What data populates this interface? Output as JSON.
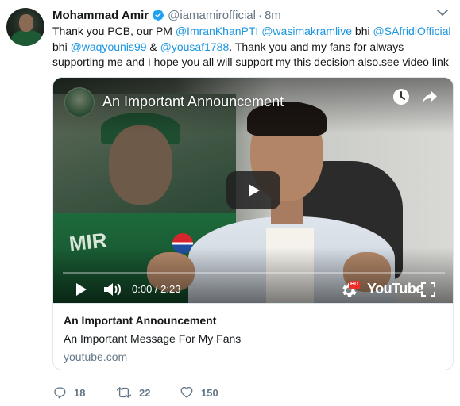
{
  "author": {
    "name": "Mohammad Amir",
    "handle": "@iamamirofficial",
    "separator": "·",
    "time": "8m",
    "verified_icon": "verified-badge-icon"
  },
  "tweet": {
    "lines": [
      [
        {
          "text": "Thank you PCB, our PM ",
          "mention": false
        },
        {
          "text": "@ImranKhanPTI",
          "mention": true
        },
        {
          "text": " ",
          "mention": false
        },
        {
          "text": "@wasimakramlive",
          "mention": true
        },
        {
          "text": " bhi ",
          "mention": false
        },
        {
          "text": "@SAfridiOfficial",
          "mention": true
        }
      ],
      [
        {
          "text": "bhi ",
          "mention": false
        },
        {
          "text": "@waqyounis99",
          "mention": true
        },
        {
          "text": " & ",
          "mention": false
        },
        {
          "text": "@yousaf1788",
          "mention": true
        },
        {
          "text": ". Thank you and my fans for always",
          "mention": false
        }
      ],
      [
        {
          "text": "supporting me and I hope you all will support my this decision also.see video link",
          "mention": false
        }
      ]
    ]
  },
  "video": {
    "title": "An Important Announcement",
    "time": "0:00 / 2:23",
    "platform": "YouTube",
    "hd_label": "HD",
    "progress_fraction": 0.0,
    "poster_text": "MIR"
  },
  "card": {
    "title": "An Important Announcement",
    "description": "An Important Message For My Fans",
    "domain": "youtube.com"
  },
  "actions": {
    "replies": "18",
    "retweets": "22",
    "likes": "150"
  },
  "colors": {
    "accent": "#1b95e0",
    "muted": "#657786",
    "text": "#14171a",
    "border": "#e1e8ed"
  }
}
